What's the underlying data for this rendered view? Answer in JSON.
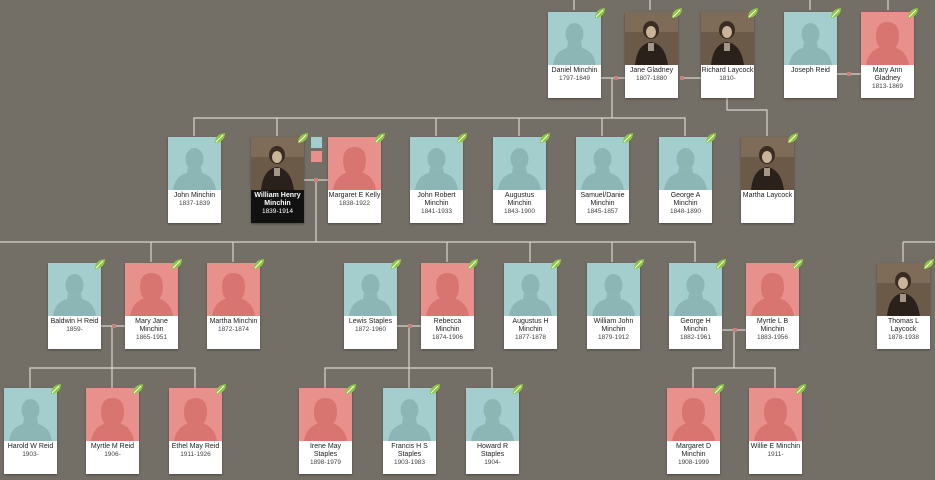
{
  "tree": {
    "leaf_icon_color": "#8dc63f",
    "male_color": "#a4cecd",
    "female_color": "#e8918c",
    "people": [
      {
        "key": "daniel",
        "name": "Daniel Minchin",
        "dates": "1797-1849",
        "gender": "male",
        "photo": false
      },
      {
        "key": "jane",
        "name": "Jane Gladney",
        "dates": "1807-1880",
        "gender": "female",
        "photo": true
      },
      {
        "key": "richard",
        "name": "Richard Laycock",
        "dates": "1810-",
        "gender": "male",
        "photo": true
      },
      {
        "key": "joseph",
        "name": "Joseph Reid",
        "dates": "",
        "gender": "male",
        "photo": false
      },
      {
        "key": "maryann",
        "name": "Mary Ann Gladney",
        "dates": "1813-1869",
        "gender": "female",
        "photo": false
      },
      {
        "key": "john",
        "name": "John Minchin",
        "dates": "1837-1839",
        "gender": "male",
        "photo": false
      },
      {
        "key": "william",
        "name": "William Henry Minchin",
        "dates": "1839-1914",
        "gender": "male",
        "photo": true,
        "selected": true
      },
      {
        "key": "margaret",
        "name": "Margaret E Kelly",
        "dates": "1838-1922",
        "gender": "female",
        "photo": false
      },
      {
        "key": "johnrobert",
        "name": "John Robert Minchin",
        "dates": "1841-1933",
        "gender": "male",
        "photo": false
      },
      {
        "key": "augustus1",
        "name": "Augustus Minchin",
        "dates": "1843-1900",
        "gender": "male",
        "photo": false
      },
      {
        "key": "samuel",
        "name": "Samuel/Danie Minchin",
        "dates": "1845-1857",
        "gender": "male",
        "photo": false
      },
      {
        "key": "georgea",
        "name": "George A Minchin",
        "dates": "1848-1890",
        "gender": "male",
        "photo": false
      },
      {
        "key": "martha1",
        "name": "Martha Laycock",
        "dates": "",
        "gender": "female",
        "photo": true
      },
      {
        "key": "baldwin",
        "name": "Baldwin H Reid",
        "dates": "1859-",
        "gender": "male",
        "photo": false
      },
      {
        "key": "maryjane",
        "name": "Mary Jane Minchin",
        "dates": "1865-1951",
        "gender": "female",
        "photo": false
      },
      {
        "key": "martha2",
        "name": "Martha Minchin",
        "dates": "1872-1874",
        "gender": "female",
        "photo": false
      },
      {
        "key": "lewis",
        "name": "Lewis Staples",
        "dates": "1872-1960",
        "gender": "male",
        "photo": false
      },
      {
        "key": "rebecca",
        "name": "Rebecca Minchin",
        "dates": "1874-1906",
        "gender": "female",
        "photo": false
      },
      {
        "key": "augustus2",
        "name": "Augustus H Minchin",
        "dates": "1877-1878",
        "gender": "male",
        "photo": false
      },
      {
        "key": "williamjohn",
        "name": "William John Minchin",
        "dates": "1879-1912",
        "gender": "male",
        "photo": false
      },
      {
        "key": "georgeh",
        "name": "George H Minchin",
        "dates": "1882-1961",
        "gender": "male",
        "photo": false
      },
      {
        "key": "myrtlelb",
        "name": "Myrtle L B Minchin",
        "dates": "1883-1956",
        "gender": "female",
        "photo": false
      },
      {
        "key": "thomas",
        "name": "Thomas L Laycock",
        "dates": "1878-1938",
        "gender": "male",
        "photo": true
      },
      {
        "key": "harold",
        "name": "Harold W Reid",
        "dates": "1903-",
        "gender": "male",
        "photo": false
      },
      {
        "key": "myrtlem",
        "name": "Myrtle M Reid",
        "dates": "1906-",
        "gender": "female",
        "photo": false
      },
      {
        "key": "ethel",
        "name": "Ethel May Reid",
        "dates": "1911-1926",
        "gender": "female",
        "photo": false
      },
      {
        "key": "irene",
        "name": "Irene May Staples",
        "dates": "1898-1979",
        "gender": "female",
        "photo": false
      },
      {
        "key": "francis",
        "name": "Francis H S Staples",
        "dates": "1903-1983",
        "gender": "male",
        "photo": false
      },
      {
        "key": "howard",
        "name": "Howard R Staples",
        "dates": "1904-",
        "gender": "male",
        "photo": false
      },
      {
        "key": "margaretd",
        "name": "Margaret D Minchin",
        "dates": "1908-1999",
        "gender": "female",
        "photo": false
      },
      {
        "key": "willie",
        "name": "Willie E Minchin",
        "dates": "1911-",
        "gender": "female",
        "photo": false
      }
    ]
  }
}
